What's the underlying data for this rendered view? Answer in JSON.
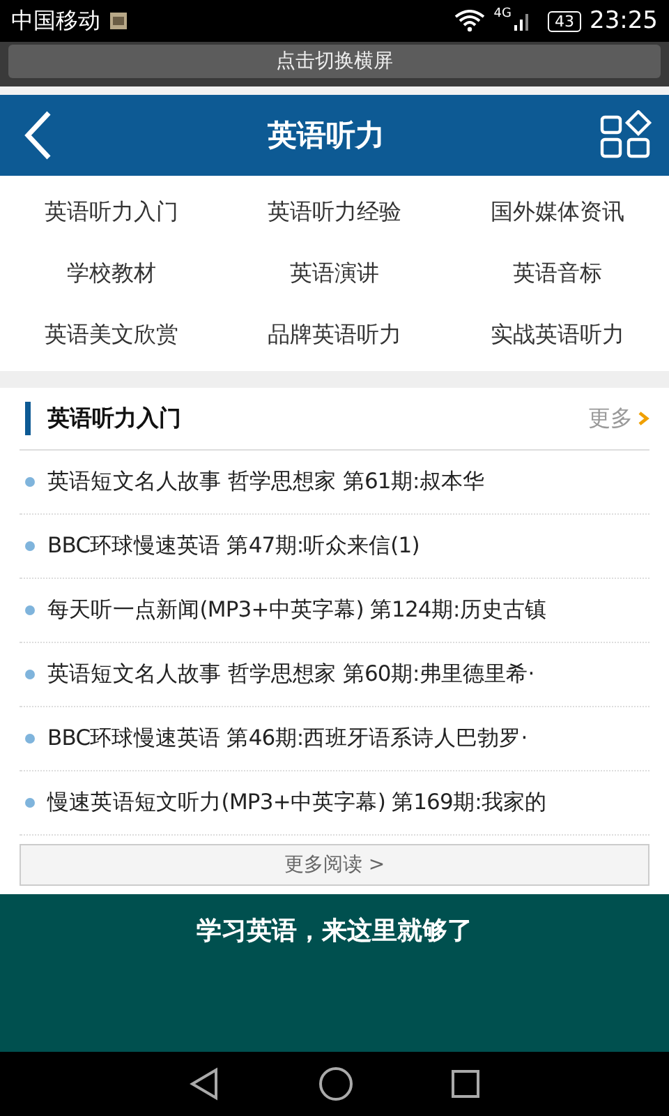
{
  "status_bar": {
    "carrier": "中国移动",
    "network": "4G",
    "battery": "43",
    "time": "23:25"
  },
  "banner": {
    "text": "点击切换横屏"
  },
  "header": {
    "title": "英语听力"
  },
  "categories": [
    {
      "label": "英语听力入门"
    },
    {
      "label": "英语听力经验"
    },
    {
      "label": "国外媒体资讯"
    },
    {
      "label": "学校教材"
    },
    {
      "label": "英语演讲"
    },
    {
      "label": "英语音标"
    },
    {
      "label": "英语美文欣赏"
    },
    {
      "label": "品牌英语听力"
    },
    {
      "label": "实战英语听力"
    }
  ],
  "section": {
    "title": "英语听力入门",
    "more": "更多",
    "articles": [
      "英语短文名人故事 哲学思想家 第61期:叔本华",
      "BBC环球慢速英语 第47期:听众来信(1)",
      "每天听一点新闻(MP3+中英字幕) 第124期:历史古镇",
      "英语短文名人故事 哲学思想家 第60期:弗里德里希·",
      "BBC环球慢速英语 第46期:西班牙语系诗人巴勃罗·",
      "慢速英语短文听力(MP3+中英字幕) 第169期:我家的"
    ],
    "read_more": "更多阅读 >"
  },
  "promo": {
    "text": "学习英语，来这里就够了"
  }
}
